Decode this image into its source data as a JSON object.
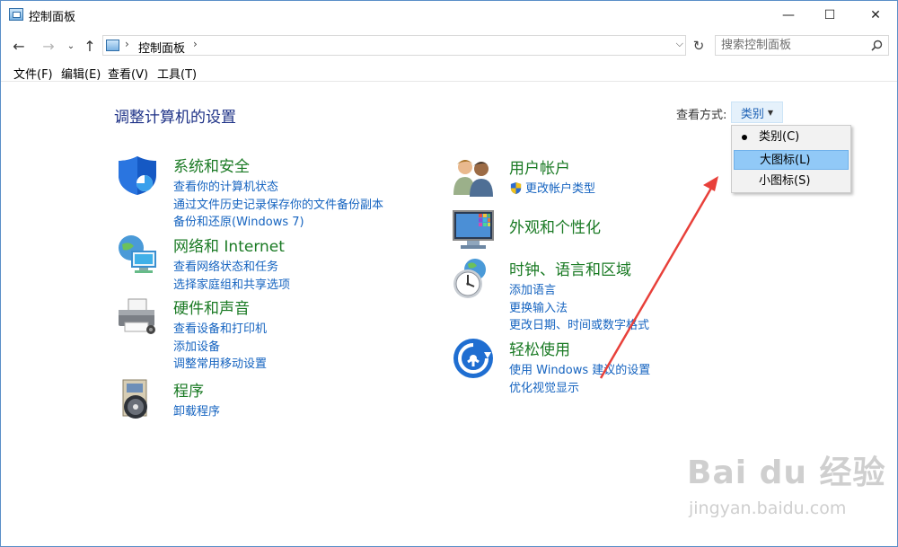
{
  "window": {
    "title": "控制面板",
    "controls": {
      "minimize": "—",
      "maximize": "☐",
      "close": "✕"
    }
  },
  "address": {
    "path": "控制面板",
    "search_placeholder": "搜索控制面板"
  },
  "menu": [
    "文件(F)",
    "编辑(E)",
    "查看(V)",
    "工具(T)"
  ],
  "main": {
    "heading": "调整计算机的设置",
    "view_by_label": "查看方式:",
    "view_by_value": "类别"
  },
  "view_dropdown": {
    "items": [
      "类别(C)",
      "大图标(L)",
      "小图标(S)"
    ],
    "selected_index": 0,
    "highlighted_index": 1
  },
  "categories": [
    {
      "title": "系统和安全",
      "icon": "shield-icon",
      "links": [
        "查看你的计算机状态",
        "通过文件历史记录保存你的文件备份副本",
        "备份和还原(Windows 7)"
      ]
    },
    {
      "title": "网络和 Internet",
      "icon": "network-globe-icon",
      "links": [
        "查看网络状态和任务",
        "选择家庭组和共享选项"
      ]
    },
    {
      "title": "硬件和声音",
      "icon": "printer-icon",
      "links": [
        "查看设备和打印机",
        "添加设备",
        "调整常用移动设置"
      ]
    },
    {
      "title": "程序",
      "icon": "programs-disc-icon",
      "links": [
        "卸载程序"
      ]
    },
    {
      "title": "用户帐户",
      "icon": "users-icon",
      "links": [
        "更改帐户类型"
      ]
    },
    {
      "title": "外观和个性化",
      "icon": "monitor-icon",
      "links": []
    },
    {
      "title": "时钟、语言和区域",
      "icon": "clock-globe-icon",
      "links": [
        "添加语言",
        "更换输入法",
        "更改日期、时间或数字格式"
      ]
    },
    {
      "title": "轻松使用",
      "icon": "ease-of-access-icon",
      "links": [
        "使用 Windows 建议的设置",
        "优化视觉显示"
      ]
    }
  ],
  "watermark": {
    "main": "Bai du 经验",
    "sub": "jingyan.baidu.com"
  },
  "colors": {
    "accent_link": "#1664c0",
    "category_title": "#1a7a24",
    "heading": "#1e3287",
    "annotation_arrow": "#e8403a"
  }
}
